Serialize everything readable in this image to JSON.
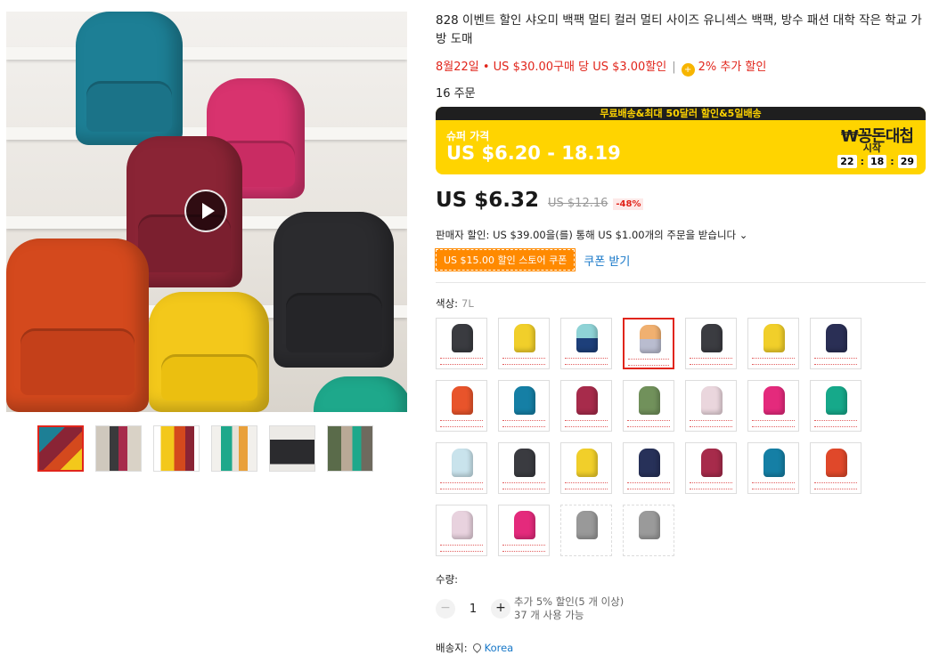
{
  "product": {
    "title": "828 이벤트 할인 샤오미 백팩 멀티 컬러 멀티 사이즈 유니섹스 백팩, 방수 패션 대학 작은 학교 가방 도매",
    "promo_text": "8월22일 • US $30.00구매 당 US $3.00할인",
    "promo_sep": "|",
    "coin_glyph": "+",
    "coin_text": "2% 추가 할인",
    "orders": "16 주문"
  },
  "banner": {
    "top_text": "무료배송&최대 50달러 할인&5일배송",
    "label": "슈퍼 가격",
    "range": "US $6.20 - 18.19",
    "brand": "₩꽁돈대첩",
    "start": "시작",
    "timer": [
      "22",
      "18",
      "29"
    ],
    "colon": ":"
  },
  "price": {
    "current": "US $6.32",
    "original": "US $12.16",
    "discount": "-48%"
  },
  "seller_discount": "판매자 할인: US $39.00을(를) 통해 US $1.00개의 주문을 받습니다 ⌄",
  "coupon": {
    "label": "US $15.00 할인 스토어 쿠폰",
    "get": "쿠폰 받기"
  },
  "color": {
    "label": "색상:",
    "value": "7L"
  },
  "swatch_colors": [
    "#3a3b40",
    "#f1cf2a",
    "#8fd3d6|#1d3f7a",
    "#f0b070|#b9bccf",
    "#3b3c41",
    "#f1cf2a",
    "#2a2f55",
    "#e8542b",
    "#157fa5",
    "#a72b4b",
    "#71915b",
    "#ead6dd",
    "#e42a7c",
    "#16a98a",
    "#c9e3ec",
    "#3a3b40",
    "#f1cf2a",
    "#273159",
    "#a72b4b",
    "#157fa5",
    "#e0482a",
    "#e8d2de",
    "#e42a7c",
    "#999999",
    "#9a9a9a"
  ],
  "quantity": {
    "label": "수량:",
    "minus": "−",
    "value": "1",
    "plus": "+",
    "info_line1": "추가 5% 할인(5 개 이상)",
    "info_line2": "37 개 사용 가능"
  },
  "shipping": {
    "label": "배송지:",
    "location": "Korea"
  }
}
